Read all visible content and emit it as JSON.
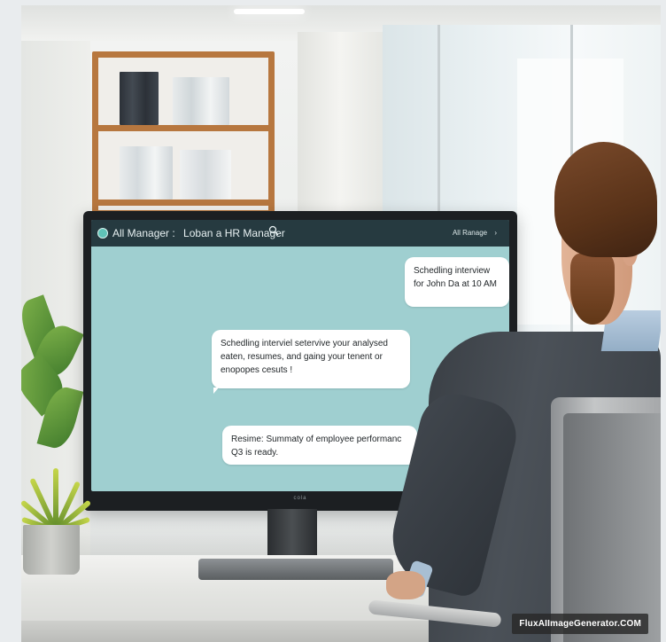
{
  "scene": {
    "description_colors": {
      "screen_bg": "#9fcfd0",
      "titlebar_bg": "#263a40",
      "shelf_wood": "#b7773f",
      "suit": "#3f454b"
    }
  },
  "app": {
    "title": "All Manager :",
    "subtitle": "Loban a HR Manager",
    "search_icon": "search-icon",
    "right_label": "All Ranage"
  },
  "messages": [
    {
      "text": "Schedling interview for John Da at 10 AM"
    },
    {
      "text": "Schedling interviel setervive your analysed eaten, resumes, and gaing your tenent or enopopes cesuts !"
    },
    {
      "text": "Resime: Summaty of employee performanc Q3 is ready."
    }
  ],
  "monitor": {
    "brand": "cola"
  },
  "watermark": "FluxAIImageGenerator.COM"
}
